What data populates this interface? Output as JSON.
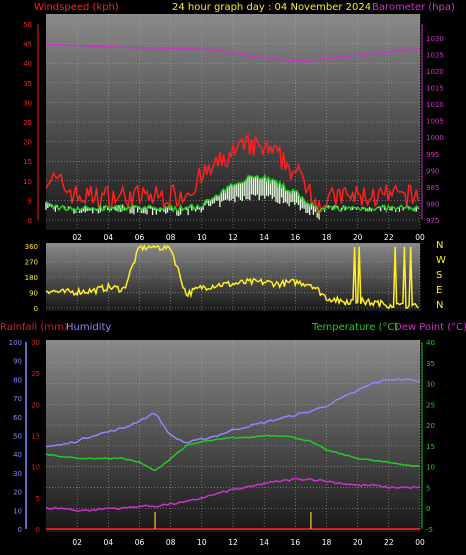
{
  "header": {
    "left": "Windspeed (kph)",
    "center": "24 hour graph day : 04 November 2024",
    "right": "Barometer (hpa)"
  },
  "colors": {
    "wind_gust": "#ff2020",
    "wind_avg": "#22cc22",
    "wind_min": "#e8ffe0",
    "barometer": "#cc33cc",
    "direction": "#ffee22",
    "humidity": "#8888ff",
    "temperature": "#22cc22",
    "dew_point": "#cc33cc",
    "rainfall": "#cc2222",
    "rain_ticks": "#ccaa22",
    "plot_top": "#8a8a8a",
    "plot_bottom": "#181818",
    "grid": "#b0b0b0"
  },
  "x_tick_labels": [
    "02",
    "04",
    "06",
    "08",
    "10",
    "12",
    "14",
    "16",
    "18",
    "20",
    "22",
    "00"
  ],
  "chart_data": [
    {
      "type": "line",
      "left_axis": {
        "label": "Windspeed (kph)",
        "ticks": [
          0,
          5,
          10,
          15,
          20,
          25,
          30,
          35,
          40,
          45,
          50
        ],
        "range": [
          0,
          50
        ]
      },
      "right_axis": {
        "label": "Barometer (hpa)",
        "ticks": [
          975,
          980,
          985,
          990,
          995,
          1000,
          1005,
          1010,
          1015,
          1020,
          1025,
          1030
        ],
        "range": [
          975,
          1033
        ]
      },
      "series": [
        {
          "name": "Windspeed",
          "role": "gust",
          "hours": [
            0,
            1,
            2,
            3,
            4,
            5,
            6,
            7,
            8,
            9,
            10,
            11,
            12,
            13,
            14,
            15,
            16,
            17,
            17.5,
            18,
            19,
            20,
            21,
            22,
            23,
            24
          ],
          "values": [
            11,
            9,
            6,
            6,
            6,
            6,
            6,
            6,
            6,
            7,
            11,
            14,
            17,
            19,
            18,
            16,
            12,
            8,
            4,
            5,
            6,
            6,
            6,
            6,
            6,
            6
          ]
        },
        {
          "role": "average",
          "hours": [
            0,
            1,
            2,
            3,
            4,
            5,
            6,
            7,
            8,
            9,
            10,
            11,
            12,
            13,
            14,
            15,
            16,
            17,
            17.5,
            18,
            19,
            20,
            21,
            22,
            23,
            24
          ],
          "values": [
            4,
            3,
            3,
            3,
            3,
            3,
            3,
            3,
            3,
            3,
            4,
            6,
            9,
            11,
            11,
            9,
            7,
            4,
            2,
            3,
            3,
            3,
            3,
            3,
            3,
            3
          ]
        },
        {
          "role": "minimum",
          "hours": [
            0,
            1,
            2,
            3,
            4,
            5,
            6,
            7,
            8,
            9,
            10,
            11,
            12,
            13,
            14,
            15,
            16,
            17,
            17.5,
            18,
            19,
            20,
            21,
            22,
            23,
            24
          ],
          "values": [
            2,
            2,
            1,
            1,
            2,
            2,
            1,
            1,
            1,
            1,
            2,
            3,
            4,
            5,
            5,
            4,
            3,
            1,
            0,
            2,
            2,
            2,
            2,
            2,
            2,
            2
          ]
        },
        {
          "name": "Barometer",
          "axis": "right",
          "hours": [
            0,
            2,
            4,
            6,
            8,
            10,
            11,
            12,
            13,
            14,
            15,
            16,
            17,
            18,
            19,
            20,
            21,
            22,
            23,
            24
          ],
          "values": [
            1028,
            1027.7,
            1027.3,
            1027,
            1026.9,
            1026.6,
            1026.2,
            1025.5,
            1024.7,
            1024,
            1023.5,
            1023.2,
            1023.3,
            1023.8,
            1024.3,
            1024.8,
            1025.3,
            1025.8,
            1026.3,
            1026.8
          ]
        }
      ]
    },
    {
      "type": "scatter",
      "left_axis": {
        "ticks": [
          0,
          90,
          180,
          270,
          360
        ],
        "range": [
          0,
          360
        ]
      },
      "right_axis_labels": [
        "N",
        "W",
        "S",
        "E",
        "N"
      ],
      "series": [
        {
          "role": "wind_direction",
          "hours": [
            0,
            1,
            2,
            3,
            4,
            5,
            6,
            7,
            8,
            9,
            10,
            11,
            12,
            13,
            14,
            15,
            16,
            17,
            18,
            19,
            20,
            21,
            22,
            23,
            24
          ],
          "values": [
            105,
            90,
            95,
            100,
            120,
            110,
            350,
            355,
            350,
            80,
            120,
            135,
            140,
            150,
            150,
            140,
            150,
            140,
            60,
            40,
            40,
            30,
            20,
            10,
            5
          ]
        }
      ]
    },
    {
      "type": "line",
      "left_axis_humidity": {
        "label": "Humidity",
        "ticks": [
          0,
          10,
          20,
          30,
          40,
          50,
          60,
          70,
          80,
          90,
          100
        ],
        "range": [
          0,
          100
        ]
      },
      "left_axis_rain": {
        "label": "Rainfall (mm)",
        "ticks": [
          0,
          5,
          10,
          15,
          20,
          25,
          30
        ],
        "range": [
          0,
          30
        ]
      },
      "right_axis": {
        "label": "Temperature (°C)",
        "ticks": [
          -5,
          0,
          5,
          10,
          15,
          20,
          25,
          30,
          35,
          40
        ],
        "range": [
          -5,
          40
        ]
      },
      "right_axis_alt_label": "Dew Point (°C)",
      "series": [
        {
          "name": "Humidity",
          "hours": [
            0,
            1,
            2,
            3,
            4,
            5,
            6,
            7,
            8,
            9,
            10,
            11,
            12,
            13,
            14,
            15,
            16,
            17,
            18,
            19,
            20,
            21,
            22,
            23,
            24
          ],
          "values": [
            44,
            45,
            47,
            50,
            52,
            54,
            58,
            62,
            50,
            46,
            48,
            50,
            53,
            55,
            57,
            59,
            61,
            63,
            66,
            70,
            74,
            78,
            80,
            80,
            79
          ]
        },
        {
          "name": "Temperature (°C)",
          "hours": [
            0,
            1,
            2,
            3,
            4,
            5,
            6,
            7,
            8,
            9,
            10,
            11,
            12,
            13,
            14,
            15,
            16,
            17,
            18,
            19,
            20,
            21,
            22,
            23,
            24
          ],
          "values": [
            13,
            12.5,
            12,
            12,
            12,
            12,
            11,
            9,
            12,
            15,
            16,
            16.5,
            17,
            17,
            17.5,
            17.5,
            17,
            16,
            14,
            13,
            12,
            11.5,
            11,
            10.5,
            10
          ]
        },
        {
          "name": "Dew Point (°C)",
          "hours": [
            0,
            1,
            2,
            3,
            4,
            5,
            6,
            7,
            8,
            9,
            10,
            11,
            12,
            13,
            14,
            15,
            16,
            17,
            18,
            19,
            20,
            21,
            22,
            23,
            24
          ],
          "values": [
            0,
            0,
            -0.5,
            -0.5,
            0,
            0,
            0.5,
            0.5,
            1,
            1.5,
            2.5,
            3.5,
            4.5,
            5,
            6,
            6.5,
            7,
            7,
            6.5,
            6,
            5.5,
            5.5,
            5,
            5,
            5
          ]
        },
        {
          "name": "Rainfall (mm)",
          "hours": [
            0,
            6.9,
            7,
            17,
            17.1,
            24
          ],
          "values": [
            0,
            0,
            0,
            0,
            0,
            0
          ]
        }
      ]
    }
  ]
}
